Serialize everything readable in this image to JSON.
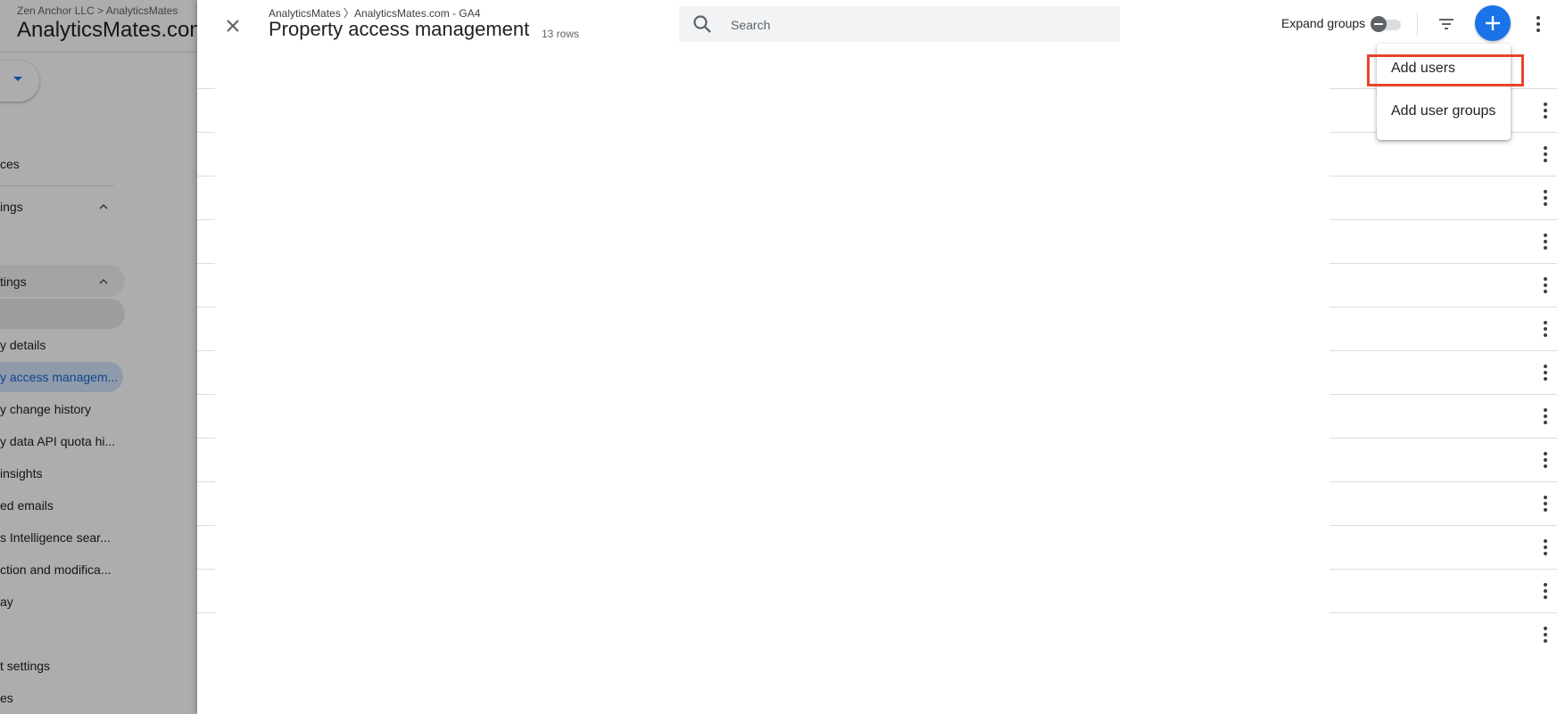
{
  "background": {
    "breadcrumb": "Zen Anchor LLC > AnalyticsMates",
    "title": "AnalyticsMates.com",
    "nav": {
      "items": [
        {
          "label": "ces"
        },
        {
          "label": "ings"
        },
        {
          "label": "tings"
        },
        {
          "label": "y details"
        },
        {
          "label": "y access managem..."
        },
        {
          "label": "y change history"
        },
        {
          "label": "y data API quota hi..."
        },
        {
          "label": "insights"
        },
        {
          "label": "ed emails"
        },
        {
          "label": "s Intelligence sear..."
        },
        {
          "label": "ction and modifica..."
        },
        {
          "label": "ay"
        },
        {
          "label": "t settings"
        },
        {
          "label": "es"
        }
      ]
    }
  },
  "panel": {
    "breadcrumb": "AnalyticsMates 〉AnalyticsMates.com - GA4",
    "title": "Property access management",
    "row_count": "13 rows",
    "search": {
      "placeholder": "Search",
      "value": ""
    },
    "expand_groups_label": "Expand groups",
    "expand_groups_on": false,
    "row_total": 13
  },
  "add_menu": {
    "items": [
      {
        "label": "Add users",
        "highlighted": true
      },
      {
        "label": "Add user groups",
        "highlighted": false
      }
    ]
  },
  "colors": {
    "accent": "#1a73e8",
    "highlight_box": "#e8442b",
    "scrim": "rgba(0,0,0,0.32)"
  },
  "icons": {
    "close": "close-icon",
    "search": "search-icon",
    "filter": "filter-icon",
    "add": "plus-icon",
    "more": "more-vert-icon"
  }
}
